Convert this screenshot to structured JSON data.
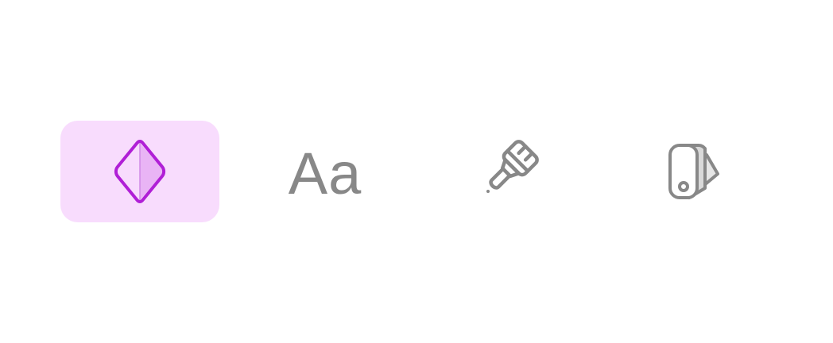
{
  "toolbar": {
    "selected_tool": "components",
    "accent_color": "#b01fd6",
    "accent_background": "#f8dcfd",
    "icon_color": "#888888",
    "tools": [
      {
        "id": "components",
        "icon": "diamond-icon",
        "selected": true
      },
      {
        "id": "text",
        "icon": "text-icon",
        "glyph": "Aa",
        "selected": false
      },
      {
        "id": "brush",
        "icon": "paintbrush-icon",
        "selected": false
      },
      {
        "id": "swatches",
        "icon": "swatch-book-icon",
        "selected": false
      }
    ]
  }
}
